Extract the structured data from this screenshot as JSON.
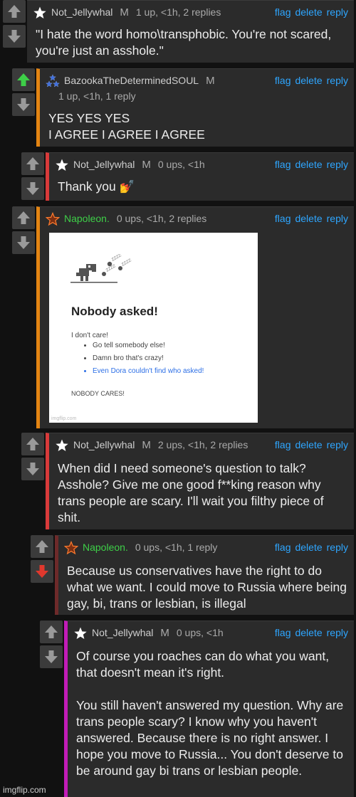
{
  "colors": {
    "link": "#2ea6ff",
    "orange": "#e38412",
    "red": "#d93a3a",
    "darkred": "#6e2a2a",
    "magenta": "#c21cb8",
    "upvote_active": "#3ecf48",
    "downvote_active": "#e0382d"
  },
  "actions": {
    "flag": "flag",
    "delete": "delete",
    "reply": "reply"
  },
  "comments": [
    {
      "user": "Not_Jellywhal",
      "mod": "M",
      "meta": "1 up, <1h, 2 replies",
      "body": "\"I hate the word homo\\transphobic. You're not scared, you're just an asshole.\"",
      "star": "white-star-icon"
    },
    {
      "user": "BazookaTheDeterminedSOUL",
      "mod": "M",
      "meta": "1 up, <1h, 1 reply",
      "body": "YES YES YES\nI AGREE I AGREE I AGREE",
      "star": "blue-triple-star-icon",
      "upvoted": true
    },
    {
      "user": "Not_Jellywhal",
      "mod": "M",
      "meta": "0 ups, <1h",
      "body": "Thank you 💅",
      "star": "white-star-icon"
    },
    {
      "user": "Napoleon.",
      "mod": "",
      "meta": "0 ups, <1h, 2 replies",
      "body": "",
      "star": "orange-star-icon"
    },
    {
      "user": "Not_Jellywhal",
      "mod": "M",
      "meta": "2 ups, <1h, 2 replies",
      "body": "When did I need someone's question to talk? Asshole? Give me one good f**king reason why trans people are scary. I'll wait you filthy piece of shit.",
      "star": "white-star-icon"
    },
    {
      "user": "Napoleon.",
      "mod": "",
      "meta": "0 ups, <1h, 1 reply",
      "body": "Because us conservatives have the right to do what we want. I could move to Russia where being gay, bi, trans or lesbian, is illegal",
      "star": "orange-star-icon",
      "downvoted": true
    },
    {
      "user": "Not_Jellywhal",
      "mod": "M",
      "meta": "0 ups, <1h",
      "body": "Of course you roaches can do what you want, that doesn't mean it's right.\n\nYou still haven't answered my question. Why are trans people scary? I know why you haven't answered. Because there is no right answer. I hope you move to Russia... You don't deserve to be around gay bi trans or lesbian people.",
      "star": "white-star-icon"
    }
  ],
  "meme": {
    "title": "Nobody asked!",
    "line1": "I don't care!",
    "bullets": [
      "Go tell somebody else!",
      "Damn bro that's crazy!",
      "Even Dora couldn't find who asked!"
    ],
    "footer": "NOBODY CARES!",
    "watermark": "imgflip.com",
    "meteor_text": "ZZZZ"
  },
  "site_watermark": "imgflip.com"
}
